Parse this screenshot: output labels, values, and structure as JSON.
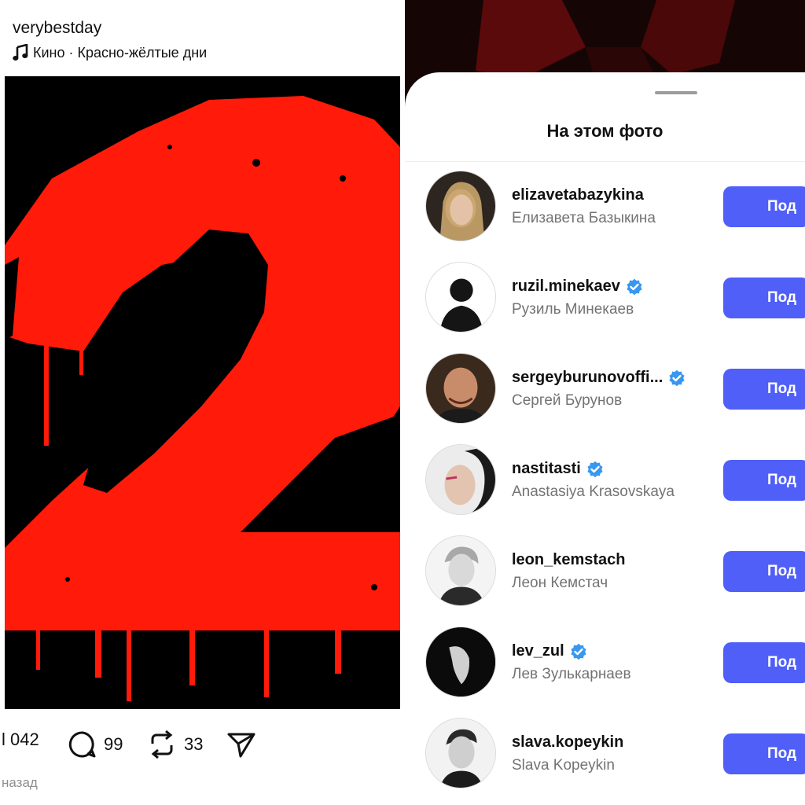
{
  "left": {
    "username": "verybestday",
    "music": "Кино · Красно-жёлтые дни",
    "actions": {
      "likes": "l 042",
      "comments": "99",
      "reposts": "33"
    },
    "timestamp": "назад"
  },
  "right": {
    "title": "На этом фото",
    "follow_label": "Под",
    "people": [
      {
        "username": "elizavetabazykina",
        "name": "Елизавета Базыкина",
        "verified": false
      },
      {
        "username": "ruzil.minekaev",
        "name": "Рузиль Минекаев",
        "verified": true
      },
      {
        "username": "sergeyburunovoffi...",
        "name": "Сергей Бурунов",
        "verified": true
      },
      {
        "username": "nastitasti",
        "name": "Anastasiya Krasovskaya",
        "verified": true
      },
      {
        "username": "leon_kemstach",
        "name": "Леон Кемстач",
        "verified": false
      },
      {
        "username": "lev_zul",
        "name": "Лев Зулькарнаев",
        "verified": true
      },
      {
        "username": "slava.kopeykin",
        "name": "Slava Kopeykin",
        "verified": false
      }
    ]
  },
  "colors": {
    "follow_button": "#4f5ff7",
    "verified_badge": "#3897f0",
    "poster_red": "#ff1a0a",
    "poster_black": "#000000"
  },
  "icons": [
    "music-note-icon",
    "comment-icon",
    "repost-icon",
    "share-icon",
    "verified-icon"
  ]
}
